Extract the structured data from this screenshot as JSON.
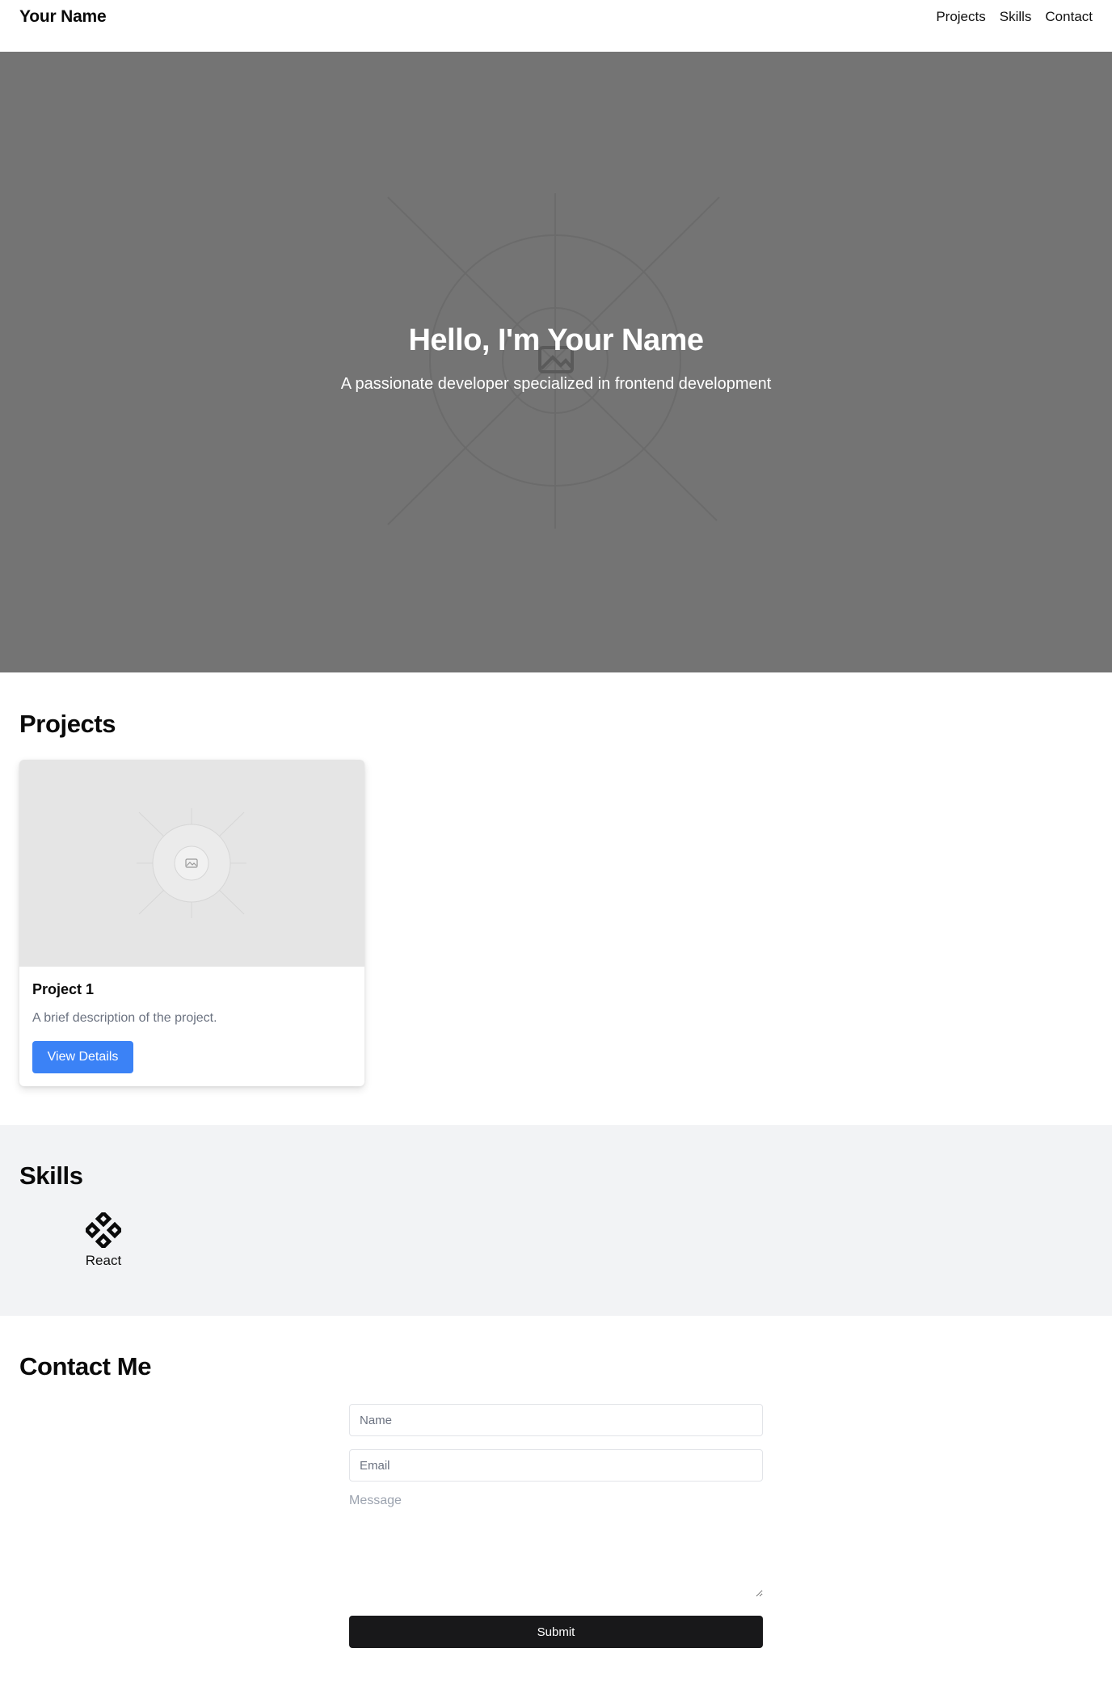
{
  "header": {
    "brand": "Your Name",
    "nav": [
      "Projects",
      "Skills",
      "Contact"
    ]
  },
  "hero": {
    "title": "Hello, I'm Your Name",
    "subtitle": "A passionate developer specialized in frontend development",
    "background_color": "#747474",
    "image_icon": "image-placeholder-icon"
  },
  "projects": {
    "title": "Projects",
    "items": [
      {
        "title": "Project 1",
        "description": "A brief description of the project.",
        "button_label": "View Details",
        "image_icon": "image-placeholder-icon"
      }
    ],
    "button_color": "#3b82f6"
  },
  "skills": {
    "title": "Skills",
    "items": [
      {
        "label": "React",
        "icon": "react-icon"
      }
    ],
    "background_color": "#f2f3f5"
  },
  "contact": {
    "title": "Contact Me",
    "name_placeholder": "Name",
    "email_placeholder": "Email",
    "message_placeholder": "Message",
    "submit_label": "Submit",
    "submit_color": "#18181a"
  }
}
